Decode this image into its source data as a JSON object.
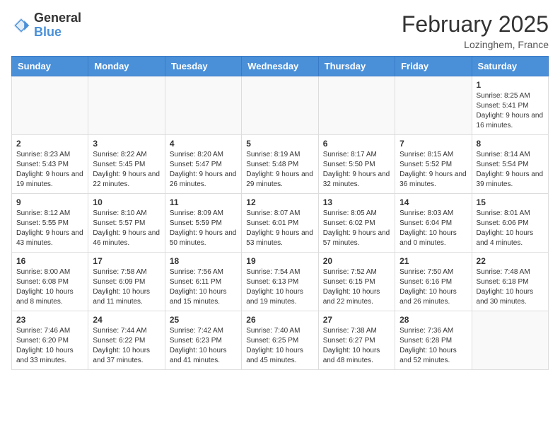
{
  "logo": {
    "general": "General",
    "blue": "Blue"
  },
  "title": {
    "month_year": "February 2025",
    "location": "Lozinghem, France"
  },
  "weekdays": [
    "Sunday",
    "Monday",
    "Tuesday",
    "Wednesday",
    "Thursday",
    "Friday",
    "Saturday"
  ],
  "weeks": [
    [
      {
        "day": "",
        "info": ""
      },
      {
        "day": "",
        "info": ""
      },
      {
        "day": "",
        "info": ""
      },
      {
        "day": "",
        "info": ""
      },
      {
        "day": "",
        "info": ""
      },
      {
        "day": "",
        "info": ""
      },
      {
        "day": "1",
        "info": "Sunrise: 8:25 AM\nSunset: 5:41 PM\nDaylight: 9 hours and 16 minutes."
      }
    ],
    [
      {
        "day": "2",
        "info": "Sunrise: 8:23 AM\nSunset: 5:43 PM\nDaylight: 9 hours and 19 minutes."
      },
      {
        "day": "3",
        "info": "Sunrise: 8:22 AM\nSunset: 5:45 PM\nDaylight: 9 hours and 22 minutes."
      },
      {
        "day": "4",
        "info": "Sunrise: 8:20 AM\nSunset: 5:47 PM\nDaylight: 9 hours and 26 minutes."
      },
      {
        "day": "5",
        "info": "Sunrise: 8:19 AM\nSunset: 5:48 PM\nDaylight: 9 hours and 29 minutes."
      },
      {
        "day": "6",
        "info": "Sunrise: 8:17 AM\nSunset: 5:50 PM\nDaylight: 9 hours and 32 minutes."
      },
      {
        "day": "7",
        "info": "Sunrise: 8:15 AM\nSunset: 5:52 PM\nDaylight: 9 hours and 36 minutes."
      },
      {
        "day": "8",
        "info": "Sunrise: 8:14 AM\nSunset: 5:54 PM\nDaylight: 9 hours and 39 minutes."
      }
    ],
    [
      {
        "day": "9",
        "info": "Sunrise: 8:12 AM\nSunset: 5:55 PM\nDaylight: 9 hours and 43 minutes."
      },
      {
        "day": "10",
        "info": "Sunrise: 8:10 AM\nSunset: 5:57 PM\nDaylight: 9 hours and 46 minutes."
      },
      {
        "day": "11",
        "info": "Sunrise: 8:09 AM\nSunset: 5:59 PM\nDaylight: 9 hours and 50 minutes."
      },
      {
        "day": "12",
        "info": "Sunrise: 8:07 AM\nSunset: 6:01 PM\nDaylight: 9 hours and 53 minutes."
      },
      {
        "day": "13",
        "info": "Sunrise: 8:05 AM\nSunset: 6:02 PM\nDaylight: 9 hours and 57 minutes."
      },
      {
        "day": "14",
        "info": "Sunrise: 8:03 AM\nSunset: 6:04 PM\nDaylight: 10 hours and 0 minutes."
      },
      {
        "day": "15",
        "info": "Sunrise: 8:01 AM\nSunset: 6:06 PM\nDaylight: 10 hours and 4 minutes."
      }
    ],
    [
      {
        "day": "16",
        "info": "Sunrise: 8:00 AM\nSunset: 6:08 PM\nDaylight: 10 hours and 8 minutes."
      },
      {
        "day": "17",
        "info": "Sunrise: 7:58 AM\nSunset: 6:09 PM\nDaylight: 10 hours and 11 minutes."
      },
      {
        "day": "18",
        "info": "Sunrise: 7:56 AM\nSunset: 6:11 PM\nDaylight: 10 hours and 15 minutes."
      },
      {
        "day": "19",
        "info": "Sunrise: 7:54 AM\nSunset: 6:13 PM\nDaylight: 10 hours and 19 minutes."
      },
      {
        "day": "20",
        "info": "Sunrise: 7:52 AM\nSunset: 6:15 PM\nDaylight: 10 hours and 22 minutes."
      },
      {
        "day": "21",
        "info": "Sunrise: 7:50 AM\nSunset: 6:16 PM\nDaylight: 10 hours and 26 minutes."
      },
      {
        "day": "22",
        "info": "Sunrise: 7:48 AM\nSunset: 6:18 PM\nDaylight: 10 hours and 30 minutes."
      }
    ],
    [
      {
        "day": "23",
        "info": "Sunrise: 7:46 AM\nSunset: 6:20 PM\nDaylight: 10 hours and 33 minutes."
      },
      {
        "day": "24",
        "info": "Sunrise: 7:44 AM\nSunset: 6:22 PM\nDaylight: 10 hours and 37 minutes."
      },
      {
        "day": "25",
        "info": "Sunrise: 7:42 AM\nSunset: 6:23 PM\nDaylight: 10 hours and 41 minutes."
      },
      {
        "day": "26",
        "info": "Sunrise: 7:40 AM\nSunset: 6:25 PM\nDaylight: 10 hours and 45 minutes."
      },
      {
        "day": "27",
        "info": "Sunrise: 7:38 AM\nSunset: 6:27 PM\nDaylight: 10 hours and 48 minutes."
      },
      {
        "day": "28",
        "info": "Sunrise: 7:36 AM\nSunset: 6:28 PM\nDaylight: 10 hours and 52 minutes."
      },
      {
        "day": "",
        "info": ""
      }
    ]
  ]
}
